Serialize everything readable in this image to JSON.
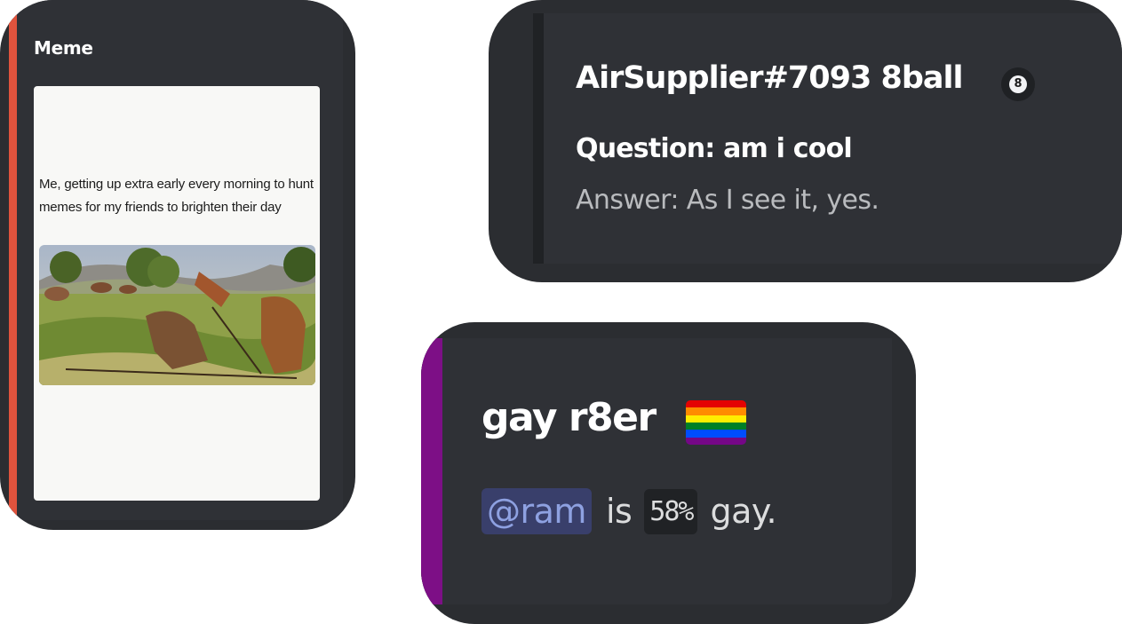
{
  "meme_embed": {
    "title": "Meme",
    "accent_color": "#e0533d",
    "image_caption": "Me, getting up extra early every morning to hunt memes for my friends to brighten their day"
  },
  "eightball_embed": {
    "title": "AirSupplier#7093 8ball",
    "question": "Question: am i cool",
    "answer": "Answer: As I see it, yes.",
    "icon": "8-ball-icon",
    "icon_glyph": "8"
  },
  "rater_embed": {
    "title": "gay r8er",
    "accent_color": "#7d0f86",
    "flag_icon": "rainbow-flag-icon",
    "mention": "@ram",
    "text_is": "is",
    "percentage": "58%",
    "text_suffix": "gay."
  }
}
